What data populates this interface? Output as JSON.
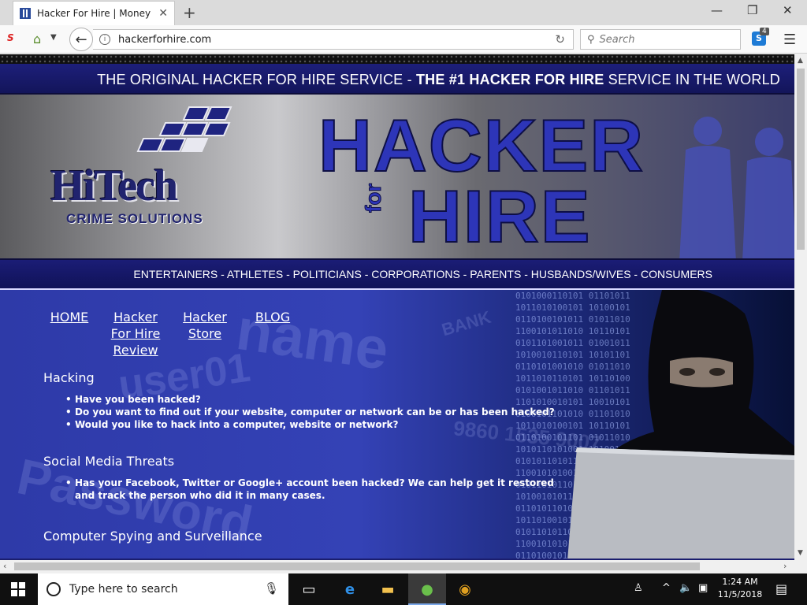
{
  "browser": {
    "tab_title": "Hacker For Hire | Money B...",
    "url": "hackerforhire.com",
    "search_placeholder": "Search",
    "skype_badge": "4",
    "addon_label": "S",
    "skype_label": "S"
  },
  "page": {
    "tagline_prefix": "THE ORIGINAL HACKER FOR HIRE SERVICE - ",
    "tagline_bold": "THE #1 HACKER FOR HIRE",
    "tagline_suffix": " SERVICE IN THE WORLD",
    "logo_main": "HiTech",
    "logo_sub": "CRIME SOLUTIONS",
    "banner_word1": "HACKER",
    "banner_word_for": "for",
    "banner_word2": "HIRE",
    "audience": "ENTERTAINERS - ATHLETES - POLITICIANS - CORPORATIONS - PARENTS - HUSBANDS/WIVES - CONSUMERS",
    "nav": {
      "home": "HOME",
      "review_line1": "Hacker",
      "review_line2": "For Hire",
      "review_line3": "Review",
      "store_line1": "Hacker",
      "store_line2": "Store",
      "blog": "BLOG"
    },
    "sections": [
      {
        "heading": "Hacking",
        "items": [
          "Have you been hacked?",
          "Do you want to find out if your website, computer or network can be or has been hacked?",
          "Would you like to hack into a computer, website or network?"
        ]
      },
      {
        "heading": "Social Media Threats",
        "items": [
          "Has your Facebook, Twitter or Google+ account been hacked? We can help get it restored and track the person who did it in many cases."
        ]
      },
      {
        "heading": "Computer Spying and Surveillance",
        "items": []
      }
    ],
    "hero_bg_words": [
      "name",
      "user01",
      "Password",
      "BANK",
      "9860 1535 9007"
    ]
  },
  "taskbar": {
    "search_placeholder": "Type here to search",
    "time": "1:24 AM",
    "date": "11/5/2018"
  },
  "colors": {
    "brand_navy": "#1b1d76",
    "brand_blue": "#2d35b8"
  }
}
